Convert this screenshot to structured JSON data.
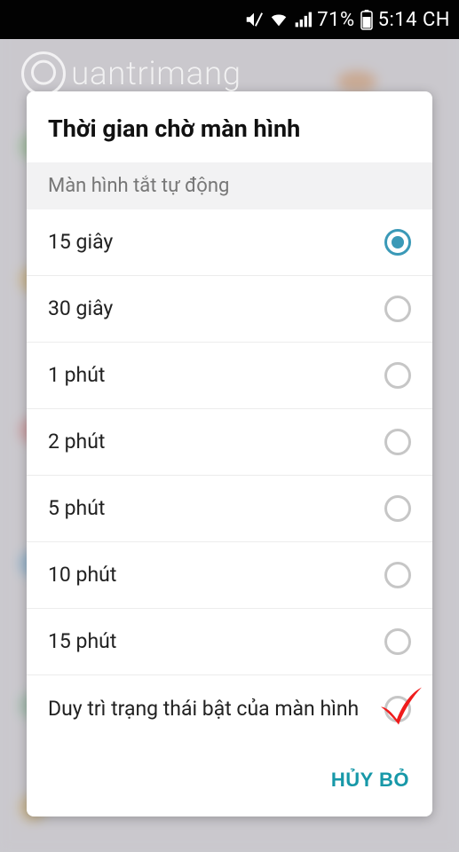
{
  "status_bar": {
    "battery_pct": "71%",
    "time": "5:14 CH",
    "icons": {
      "mute": "volume-mute-icon",
      "wifi": "wifi-icon",
      "signal": "cell-signal-icon",
      "battery": "battery-icon"
    }
  },
  "watermark": {
    "text": "uantrimang"
  },
  "dialog": {
    "title": "Thời gian chờ màn hình",
    "section_label": "Màn hình tắt tự động",
    "options": [
      {
        "label": "15 giây",
        "selected": true
      },
      {
        "label": "30 giây",
        "selected": false
      },
      {
        "label": "1 phút",
        "selected": false
      },
      {
        "label": "2 phút",
        "selected": false
      },
      {
        "label": "5 phút",
        "selected": false
      },
      {
        "label": "10 phút",
        "selected": false
      },
      {
        "label": "15 phút",
        "selected": false
      },
      {
        "label": "Duy trì trạng thái bật của màn hình",
        "selected": false,
        "annotated": true
      }
    ],
    "cancel_label": "HỦY BỎ"
  },
  "colors": {
    "accent": "#3a99b7",
    "action": "#1798a8",
    "annotation": "#ef1b1b"
  }
}
